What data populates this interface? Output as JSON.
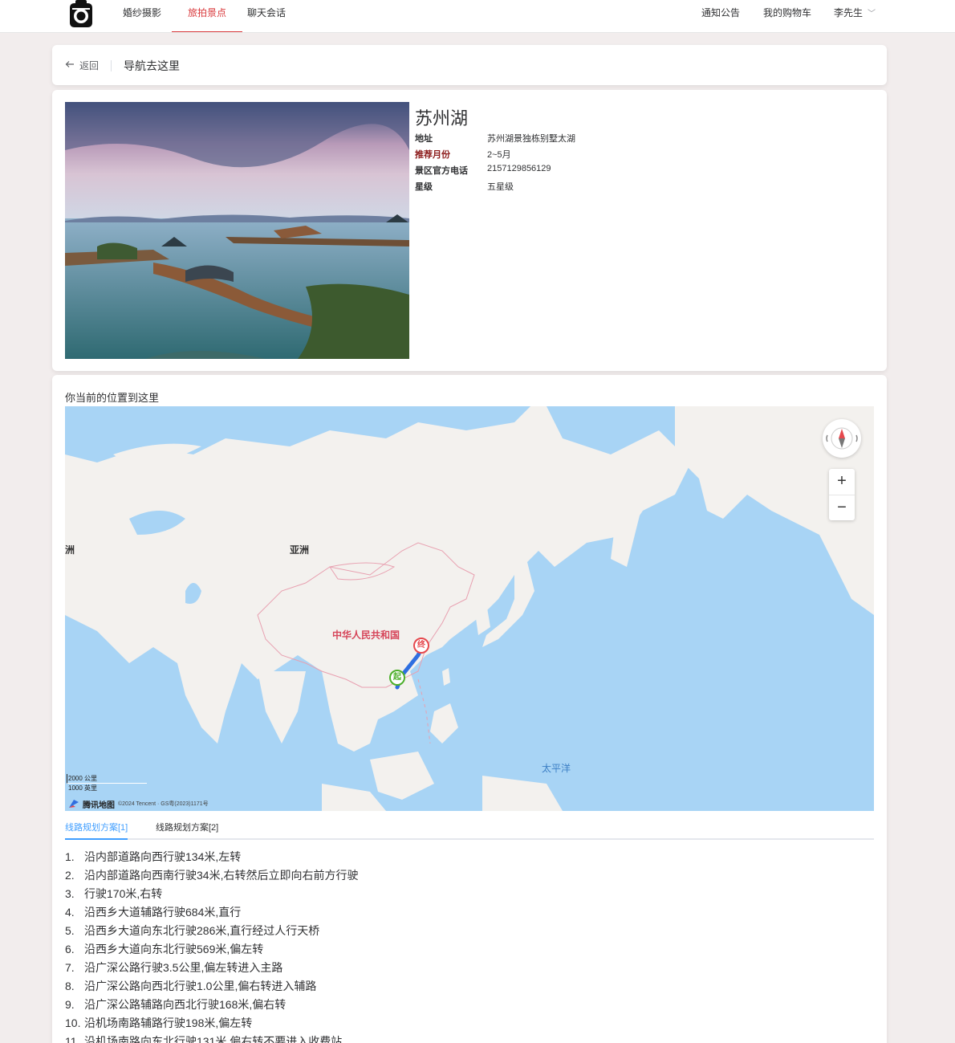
{
  "nav": {
    "items": [
      {
        "label": "婚纱摄影",
        "active": false
      },
      {
        "label": "旅拍景点",
        "active": true
      },
      {
        "label": "聊天会话",
        "active": false
      }
    ],
    "notice": "通知公告",
    "cart": "我的购物车",
    "user": "李先生"
  },
  "header": {
    "back_label": "返回",
    "title": "导航去这里"
  },
  "spot": {
    "name": "苏州湖",
    "info": [
      {
        "label": "地址",
        "value": "苏州湖景独栋别墅太湖",
        "highlight": false
      },
      {
        "label": "推荐月份",
        "value": "2~5月",
        "highlight": true
      },
      {
        "label": "景区官方电话",
        "value": "2157129856129",
        "highlight": false
      },
      {
        "label": "星级",
        "value": "五星级",
        "highlight": false
      }
    ]
  },
  "map": {
    "caption": "你当前的位置到这里",
    "labels": {
      "asia": "亚洲",
      "partial_left": "洲",
      "china": "中华人民共和国",
      "pacific": "太平洋",
      "start_marker": "起",
      "end_marker": "终"
    },
    "scale_km": "2000 公里",
    "scale_mi": "1000 英里",
    "provider": "腾讯地图",
    "copyright": "©2024 Tencent · GS粤(2023)1171号",
    "zoom_in": "+",
    "zoom_out": "−",
    "colors": {
      "water": "#a8d4f5",
      "land": "#f3f1ee",
      "route": "#2f6fe0",
      "border": "#e8a0b0"
    }
  },
  "route": {
    "tabs": [
      {
        "label": "线路规划方案[1]",
        "active": true
      },
      {
        "label": "线路规划方案[2]",
        "active": false
      }
    ],
    "steps": [
      {
        "num": "1.",
        "text": "沿内部道路向西行驶134米,左转"
      },
      {
        "num": "2.",
        "text": "沿内部道路向西南行驶34米,右转然后立即向右前方行驶"
      },
      {
        "num": "3.",
        "text": "行驶170米,右转"
      },
      {
        "num": "4.",
        "text": "沿西乡大道辅路行驶684米,直行"
      },
      {
        "num": "5.",
        "text": "沿西乡大道向东北行驶286米,直行经过人行天桥"
      },
      {
        "num": "6.",
        "text": "沿西乡大道向东北行驶569米,偏左转"
      },
      {
        "num": "7.",
        "text": "沿广深公路行驶3.5公里,偏左转进入主路"
      },
      {
        "num": "8.",
        "text": "沿广深公路向西北行驶1.0公里,偏右转进入辅路"
      },
      {
        "num": "9.",
        "text": "沿广深公路辅路向西北行驶168米,偏右转"
      },
      {
        "num": "10.",
        "text": "沿机场南路辅路行驶198米,偏左转"
      },
      {
        "num": "11.",
        "text": "沿机场南路向东北行驶131米,偏右转不要进入收费站"
      }
    ]
  }
}
